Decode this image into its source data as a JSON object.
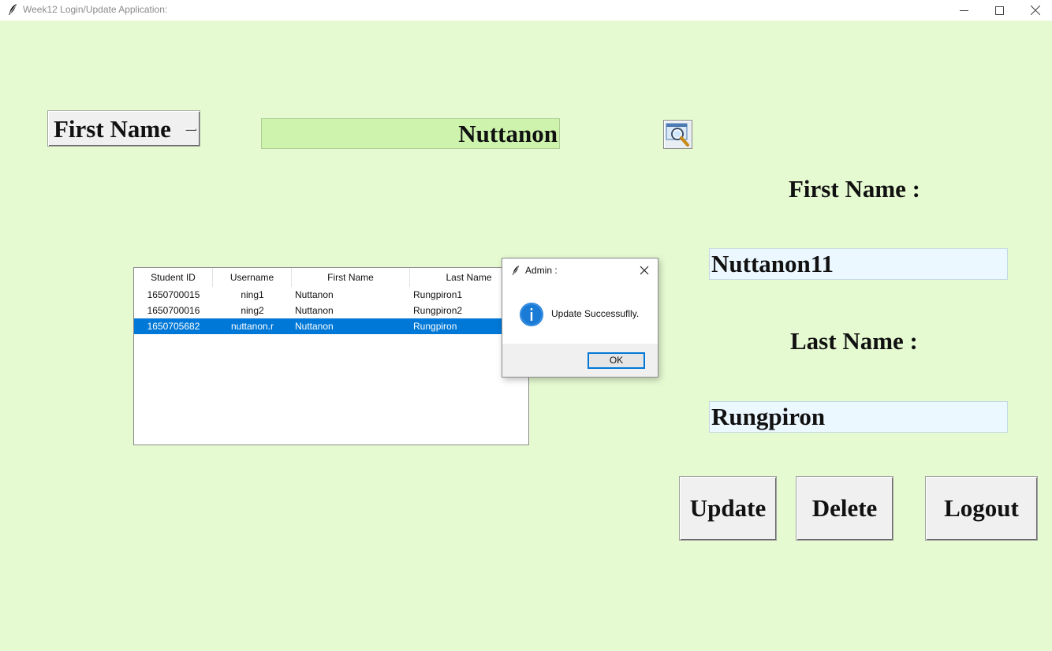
{
  "window": {
    "title": "Week12 Login/Update Application:",
    "controls": [
      "minimize-icon",
      "maximize-icon",
      "close-icon"
    ]
  },
  "search": {
    "field_option": "First Name",
    "query": "Nuttanon",
    "button_icon": "magnifier-icon"
  },
  "table": {
    "columns": [
      "Student ID",
      "Username",
      "First Name",
      "Last Name"
    ],
    "rows": [
      [
        "1650700015",
        "ning1",
        "Nuttanon",
        "Rungpiron1"
      ],
      [
        "1650700016",
        "ning2",
        "Nuttanon",
        "Rungpiron2"
      ],
      [
        "1650705682",
        "nuttanon.r",
        "Nuttanon",
        "Rungpiron"
      ]
    ],
    "selected_row": 2
  },
  "form": {
    "first_name_label": "First Name :",
    "first_name_value": "Nuttanon11",
    "last_name_label": "Last Name :",
    "last_name_value": "Rungpiron"
  },
  "actions": {
    "update": "Update",
    "delete": "Delete",
    "logout": "Logout"
  },
  "dialog": {
    "title": "Admin :",
    "message": "Update Successuflly.",
    "ok_label": "OK",
    "icon": "info-icon"
  },
  "colors": {
    "window_bg": "#e6fad2",
    "search_bg": "#cdf3ac",
    "entry_bg": "#ebf8ff",
    "selection": "#0078d7"
  }
}
